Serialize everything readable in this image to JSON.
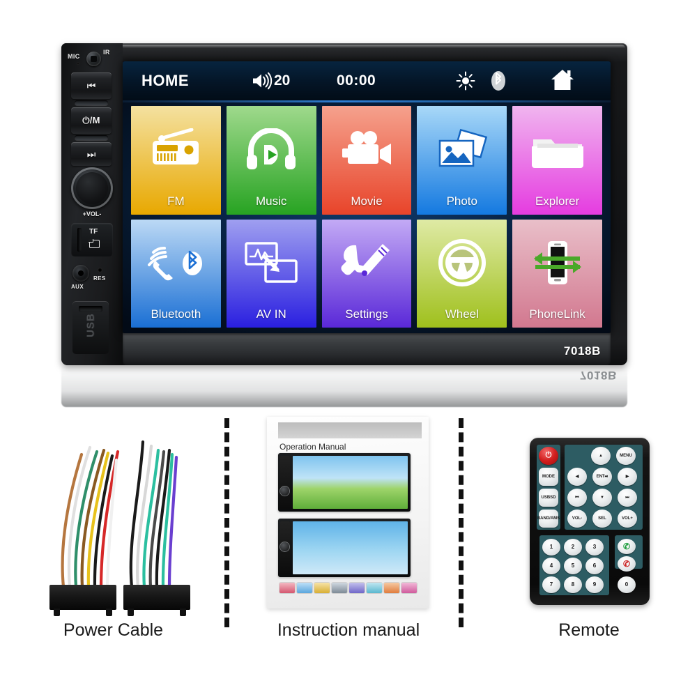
{
  "product": {
    "model_number": "7018B",
    "model_number_reflection": "7018B"
  },
  "head_unit": {
    "side_panel": {
      "mic_label": "MIC",
      "ir_label": "IR",
      "prev_button": "⏮",
      "power_mode_button": "⏻/M",
      "next_button": "⏭",
      "volume_label": "+VOL-",
      "tf_label": "TF",
      "aux_label": "AUX",
      "reset_label": "RES",
      "usb_label": "USB"
    },
    "status_bar": {
      "home_text": "HOME",
      "volume_value": "20",
      "clock": "00:00",
      "icons": {
        "speaker": "speaker-icon",
        "brightness": "brightness-icon",
        "bluetooth": "bluetooth-icon",
        "home": "home-icon"
      }
    },
    "tiles": [
      {
        "label": "FM",
        "icon": "radio-icon",
        "c1": "#f4e1a0",
        "c2": "#e8a800"
      },
      {
        "label": "Music",
        "icon": "headphones-icon",
        "c1": "#9fd98c",
        "c2": "#27a322"
      },
      {
        "label": "Movie",
        "icon": "camcorder-icon",
        "c1": "#f5a18d",
        "c2": "#e8442a"
      },
      {
        "label": "Photo",
        "icon": "photos-icon",
        "c1": "#a8d8f8",
        "c2": "#1479e0"
      },
      {
        "label": "Explorer",
        "icon": "folder-icon",
        "c1": "#f0b5ef",
        "c2": "#e53ce0"
      },
      {
        "label": "Bluetooth",
        "icon": "bt-phone-icon",
        "c1": "#bcd9f5",
        "c2": "#1a6fd4"
      },
      {
        "label": "AV IN",
        "icon": "av-in-icon",
        "c1": "#9f9ff0",
        "c2": "#2a1fe0"
      },
      {
        "label": "Settings",
        "icon": "tools-icon",
        "c1": "#c3aaf5",
        "c2": "#5a28d8"
      },
      {
        "label": "Wheel",
        "icon": "steering-icon",
        "c1": "#dfeaa5",
        "c2": "#9fc01c"
      },
      {
        "label": "PhoneLink",
        "icon": "phonelink-icon",
        "c1": "#e9bfc9",
        "c2": "#d2788f"
      }
    ]
  },
  "accessories": [
    {
      "caption": "Power Cable"
    },
    {
      "caption": "Instruction manual"
    },
    {
      "caption": "Remote"
    }
  ],
  "manual": {
    "title": "Operation Manual"
  },
  "remote": {
    "buttons": [
      {
        "label": "⏻",
        "name": "power-button"
      },
      {
        "label": "▲",
        "name": "up-button"
      },
      {
        "label": "MENU",
        "name": "menu-button"
      },
      {
        "label": "MODE",
        "name": "mode-button"
      },
      {
        "label": "◀",
        "name": "left-button"
      },
      {
        "label": "ENT\n⏯",
        "name": "enter-play-pause-button"
      },
      {
        "label": "▶",
        "name": "right-button"
      },
      {
        "label": "USB\nSD",
        "name": "usb-sd-button"
      },
      {
        "label": "⏮",
        "name": "prev-track-button"
      },
      {
        "label": "▼",
        "name": "down-button"
      },
      {
        "label": "⏭",
        "name": "next-track-button"
      },
      {
        "label": "BAND\n/AMS",
        "name": "band-ams-button"
      },
      {
        "label": "VOL-",
        "name": "volume-down-button"
      },
      {
        "label": "SEL",
        "name": "select-button"
      },
      {
        "label": "VOL+",
        "name": "volume-up-button"
      }
    ],
    "keypad": [
      "1",
      "2",
      "3",
      "4",
      "5",
      "6",
      "7",
      "8",
      "9",
      "0"
    ],
    "call_buttons": [
      {
        "label": "✆",
        "name": "answer-call-button",
        "color": "#1f9d3f"
      },
      {
        "label": "✆",
        "name": "end-call-button",
        "color": "#cc2222"
      }
    ]
  },
  "colors": {
    "screen_bg": "#0a2a52",
    "statusbar": "#041526",
    "accent_blue": "#2f7fd4",
    "body_black": "#141517"
  }
}
